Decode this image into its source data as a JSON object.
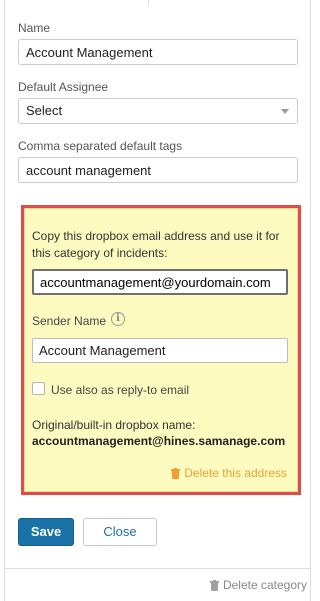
{
  "form": {
    "name": {
      "label": "Name",
      "value": "Account Management"
    },
    "default_assignee": {
      "label": "Default Assignee",
      "selected": "Select"
    },
    "tags": {
      "label": "Comma separated default tags",
      "value": "account management"
    }
  },
  "dropbox": {
    "copy_hint": "Copy this dropbox email address and use it for this category of incidents:",
    "email": "accountmanagement@yourdomain.com",
    "sender_label": "Sender Name",
    "info_icon_glyph": "i",
    "sender_value": "Account Management",
    "reply_to_label": "Use also as reply-to email",
    "original_label": "Original/built-in dropbox name:",
    "original_value": "accountmanagement@hines.samanage.com",
    "delete_label": "Delete this address"
  },
  "actions": {
    "save_label": "Save",
    "close_label": "Close"
  },
  "footer": {
    "delete_category_label": "Delete category"
  },
  "icons": {
    "info": "info-circle-icon",
    "trash": "trash-icon",
    "caret": "chevron-down-icon"
  },
  "colors": {
    "highlight_border": "#e04b4b",
    "highlight_fill": "#fefbc0",
    "primary_button": "#1a73a8",
    "delete_link": "#f0a030"
  }
}
